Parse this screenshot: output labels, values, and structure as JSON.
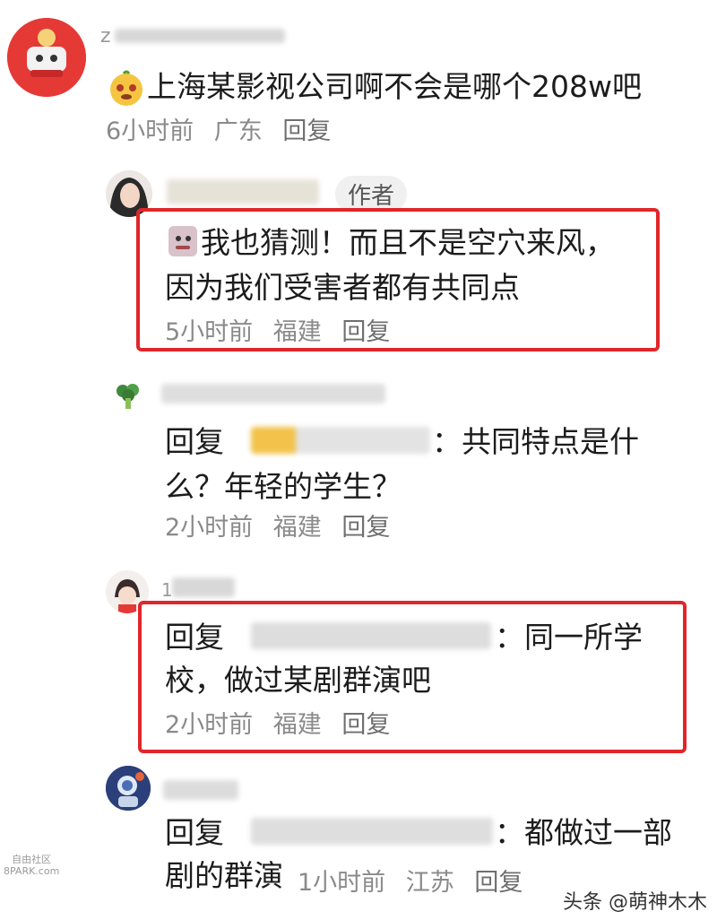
{
  "comments": [
    {
      "id": "c1",
      "username_visible": "z",
      "text": "上海某影视公司啊不会是哪个208w吧",
      "time": "6小时前",
      "location": "广东",
      "reply_label": "回复"
    },
    {
      "id": "c2",
      "badge": "作者",
      "text_line1": "我也猜测！而且不是空穴来风，",
      "text_line2": "因为我们受害者都有共同点",
      "time": "5小时前",
      "location": "福建",
      "reply_label": "回复"
    },
    {
      "id": "c3",
      "reply_prefix": "回复",
      "text_after_name": "：共同特点是什",
      "text_line2": "么？年轻的学生？",
      "time": "2小时前",
      "location": "福建",
      "reply_label": "回复"
    },
    {
      "id": "c4",
      "username_visible": "1",
      "reply_prefix": "回复",
      "text_after_name": "：同一所学",
      "text_line2": "校，做过某剧群演吧",
      "time": "2小时前",
      "location": "福建",
      "reply_label": "回复"
    },
    {
      "id": "c5",
      "reply_prefix": "回复",
      "text_after_name": "：都做过一部",
      "text_line2": "剧的群演",
      "time": "1小时前",
      "location": "江苏",
      "reply_label": "回复"
    }
  ],
  "watermark": {
    "left_line1": "自由社区",
    "left_line2": "8PARK.com",
    "right": "头条 @萌神木木"
  },
  "colors": {
    "highlight": "#e0262a",
    "meta_text": "#8a8a8a",
    "avatar_red": "#e53935"
  },
  "icons": [
    "santa-avatar-icon",
    "emoji-face-icon",
    "broccoli-avatar-icon"
  ]
}
